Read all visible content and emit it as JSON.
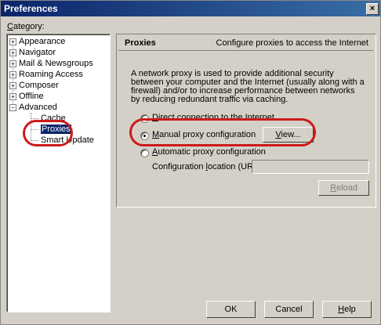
{
  "window": {
    "title": "Preferences",
    "close_glyph": "×"
  },
  "category_label": "Category:",
  "tree": {
    "items": [
      {
        "label": "Appearance",
        "expander": "+"
      },
      {
        "label": "Navigator",
        "expander": "+"
      },
      {
        "label": "Mail & Newsgroups",
        "expander": "+"
      },
      {
        "label": "Roaming Access",
        "expander": "+"
      },
      {
        "label": "Composer",
        "expander": "+"
      },
      {
        "label": "Offline",
        "expander": "+"
      },
      {
        "label": "Advanced",
        "expander": "−"
      }
    ],
    "children": [
      "Cache",
      "Proxies",
      "Smart Update"
    ],
    "selected": "Proxies"
  },
  "panel": {
    "title": "Proxies",
    "description": "Configure proxies to access the Internet",
    "intro": "A network proxy is used to provide additional security between your computer and the Internet (usually along with a firewall) and/or to increase performance between networks by reducing redundant traffic via caching.",
    "options": {
      "direct": "Direct connection to the Internet",
      "manual": "Manual proxy configuration",
      "automatic": "Automatic proxy configuration"
    },
    "selected_option": "manual",
    "view_button": "View...",
    "config_url_label": "Configuration location (URL):",
    "config_url_value": "",
    "reload_button": "Reload"
  },
  "buttons": {
    "ok": "OK",
    "cancel": "Cancel",
    "help": "Help"
  },
  "colors": {
    "highlight_circle": "#cc1a1a",
    "selection": "#0a246a",
    "titlebar": "#0a246a"
  }
}
